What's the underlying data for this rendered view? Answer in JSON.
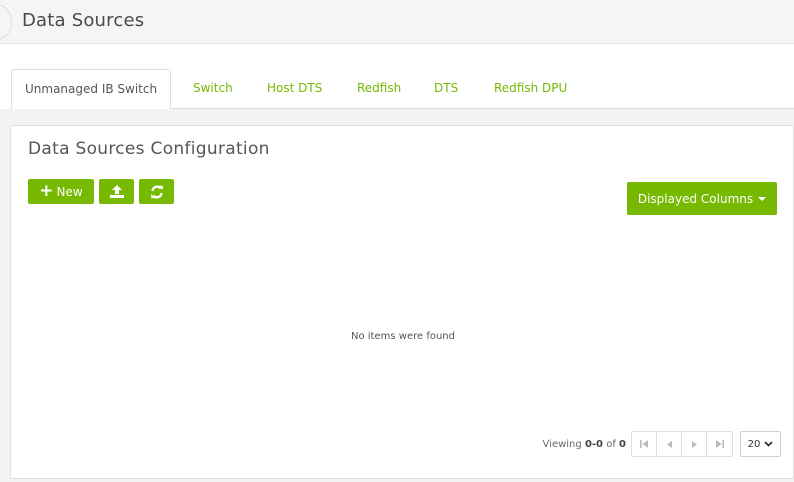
{
  "page": {
    "title": "Data Sources"
  },
  "tabs": [
    {
      "label": "Unmanaged IB Switch",
      "active": true
    },
    {
      "label": "Switch",
      "active": false
    },
    {
      "label": "Host DTS",
      "active": false
    },
    {
      "label": "Redfish",
      "active": false
    },
    {
      "label": "DTS",
      "active": false
    },
    {
      "label": "Redfish DPU",
      "active": false
    }
  ],
  "panel": {
    "title": "Data Sources Configuration",
    "new_label": "New",
    "columns_label": "Displayed Columns",
    "empty_message": "No items were found"
  },
  "pagination": {
    "viewing_prefix": "Viewing",
    "range": "0-0",
    "of_word": "of",
    "total": "0",
    "page_size": "20"
  },
  "icons": {
    "new": "plus-icon",
    "upload": "upload-icon",
    "refresh": "refresh-icon",
    "columns": "caret-down-icon",
    "first": "first-page-icon",
    "prev": "prev-page-icon",
    "next": "next-page-icon",
    "last": "last-page-icon",
    "page_size": "chevron-down-icon"
  },
  "colors": {
    "accent": "#76b900",
    "text": "#555555",
    "border": "#dddddd"
  }
}
